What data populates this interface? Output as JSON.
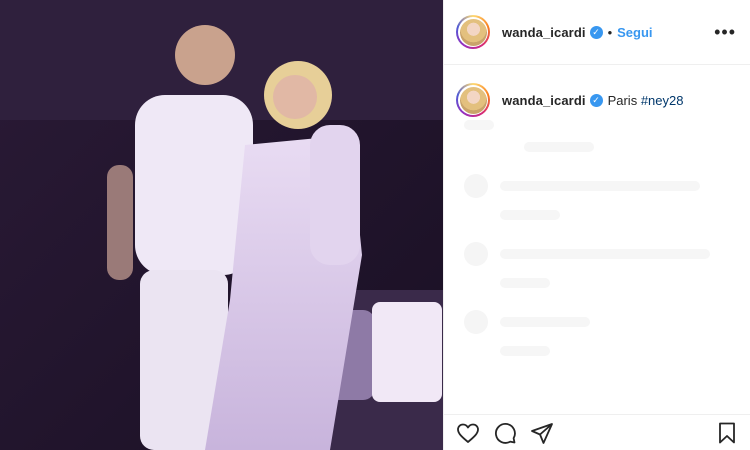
{
  "post": {
    "username": "wanda_icardi",
    "follow_label": "Segui",
    "separator": "•",
    "location_prefix": "Paris",
    "hashtag": "#ney28",
    "more_label": "•••"
  },
  "colors": {
    "link_blue": "#3897f0",
    "text": "#262626",
    "border": "#efefef"
  },
  "icons": {
    "like": "heart-icon",
    "comment": "comment-icon",
    "share": "share-icon",
    "save": "bookmark-icon",
    "verified": "verified-badge-icon"
  }
}
